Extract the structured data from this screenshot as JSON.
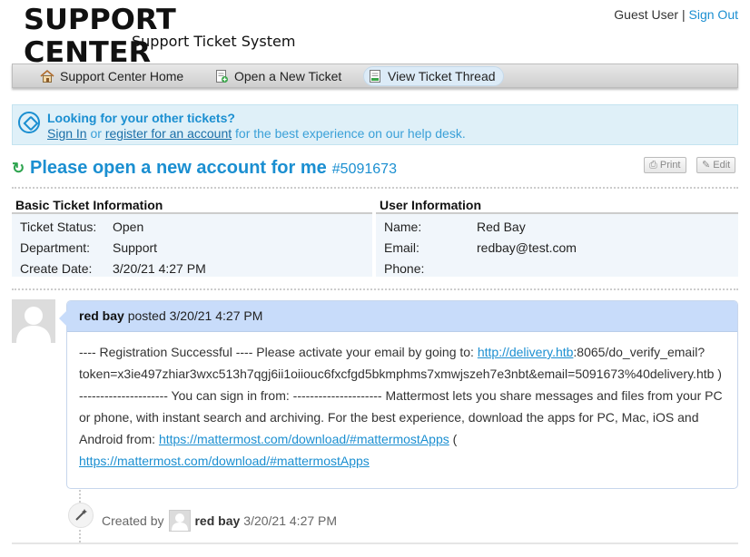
{
  "header": {
    "logo_title": "SUPPORT CENTER",
    "logo_subtitle": "Support Ticket System",
    "user_label": "Guest User",
    "separator": "|",
    "sign_out": "Sign Out"
  },
  "nav": {
    "items": [
      {
        "label": "Support Center Home",
        "icon": "home-icon"
      },
      {
        "label": "Open a New Ticket",
        "icon": "new-ticket-icon"
      },
      {
        "label": "View Ticket Thread",
        "icon": "ticket-thread-icon",
        "active": true
      }
    ]
  },
  "banner": {
    "title": "Looking for your other tickets?",
    "sign_in": "Sign In",
    "or": "or",
    "register": "register for an account",
    "suffix": "for the best experience on our help desk."
  },
  "ticket": {
    "subject": "Please open a new account for me",
    "number": "#5091673",
    "print_label": "Print",
    "edit_label": "Edit"
  },
  "basic_info": {
    "heading": "Basic Ticket Information",
    "rows": [
      {
        "label": "Ticket Status:",
        "value": "Open"
      },
      {
        "label": "Department:",
        "value": "Support"
      },
      {
        "label": "Create Date:",
        "value": "3/20/21 4:27 PM"
      }
    ]
  },
  "user_info": {
    "heading": "User Information",
    "rows": [
      {
        "label": "Name:",
        "value": "Red Bay"
      },
      {
        "label": "Email:",
        "value": "redbay@test.com"
      },
      {
        "label": "Phone:",
        "value": ""
      }
    ]
  },
  "thread": {
    "author": "red bay",
    "posted": "posted 3/20/21 4:27 PM",
    "body_part1": "---- Registration Successful ---- Please activate your email by going to: ",
    "link1": "http://delivery.htb",
    "body_part2": ":8065/do_verify_email?token=x3ie497zhiar3wxc513h7qgj6ii1oiiouc6fxcfgd5bkmphms7xmwjszeh7e3nbt&email=5091673%40delivery.htb ) --------------------- You can sign in from: --------------------- Mattermost lets you share messages and files from your PC or phone, with instant search and archiving. For the best experience, download the apps for PC, Mac, iOS and Android from: ",
    "link2": "https://mattermost.com/download/#mattermostApps",
    "body_part3": " ( ",
    "link3": "https://mattermost.com/download/#mattermostApps"
  },
  "event": {
    "created_by": "Created by",
    "author": "red bay",
    "time": "3/20/21 4:27 PM"
  },
  "colors": {
    "accent": "#1b8fd1",
    "banner_bg": "#dff0f8",
    "thread_head_bg": "#c8dcfa",
    "refresh_green": "#2ea44f"
  }
}
